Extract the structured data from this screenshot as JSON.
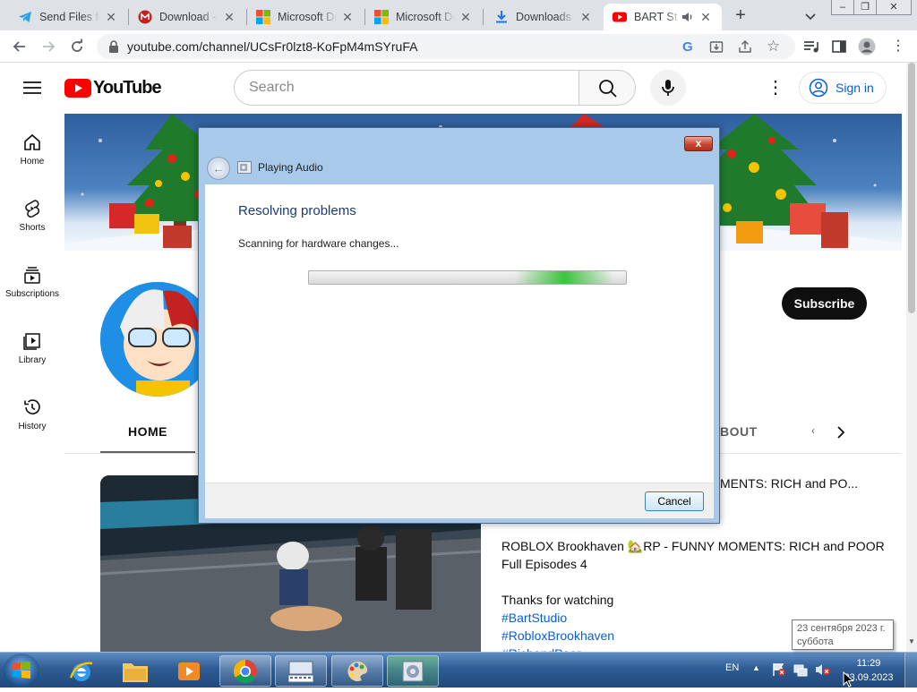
{
  "browser": {
    "tabs": [
      {
        "title": "Send Files fo",
        "icon": "telegram-icon"
      },
      {
        "title": "Download - G",
        "icon": "gmail-icon"
      },
      {
        "title": "Microsoft De",
        "icon": "microsoft-icon"
      },
      {
        "title": "Microsoft De",
        "icon": "microsoft-icon"
      },
      {
        "title": "Downloads",
        "icon": "download-icon"
      },
      {
        "title": "BART St",
        "icon": "youtube-icon",
        "active": true,
        "audio": true
      }
    ],
    "url": "youtube.com/channel/UCsFr0lzt8-KoFpM4mSYruFA"
  },
  "youtube": {
    "logo": "YouTube",
    "search_placeholder": "Search",
    "signin_label": "Sign in",
    "guide": [
      {
        "label": "Home",
        "icon": "home-icon"
      },
      {
        "label": "Shorts",
        "icon": "shorts-icon"
      },
      {
        "label": "Subscriptions",
        "icon": "subscriptions-icon"
      },
      {
        "label": "Library",
        "icon": "library-icon"
      },
      {
        "label": "History",
        "icon": "history-icon"
      }
    ],
    "subscribe_label": "Subscribe",
    "channel_tabs": {
      "home": "HOME",
      "about": "BOUT"
    },
    "video_title_partial": "MENTS: RICH and PO...",
    "description": {
      "line1": "ROBLOX Brookhaven 🏡RP - FUNNY MOMENTS: RICH and POOR",
      "line2": "Full Episodes 4",
      "line3": "Thanks for watching",
      "tags": [
        "#BartStudio",
        "#RobloxBrookhaven",
        "#RichandPoor"
      ]
    }
  },
  "dialog": {
    "title": "Playing Audio",
    "heading": "Resolving problems",
    "status": "Scanning for hardware changes...",
    "progress_indeterminate": true,
    "cancel_label": "Cancel",
    "close_label": "x"
  },
  "taskbar": {
    "language": "EN",
    "time": "11:29",
    "date": "23.09.2023",
    "tooltip_date": "23 сентября 2023 г.",
    "tooltip_day": "суббота"
  },
  "colors": {
    "youtube_red": "#ff0000",
    "link_blue": "#065fd4",
    "dialog_heading": "#1c3a78",
    "progress_green": "#3cc33c"
  }
}
